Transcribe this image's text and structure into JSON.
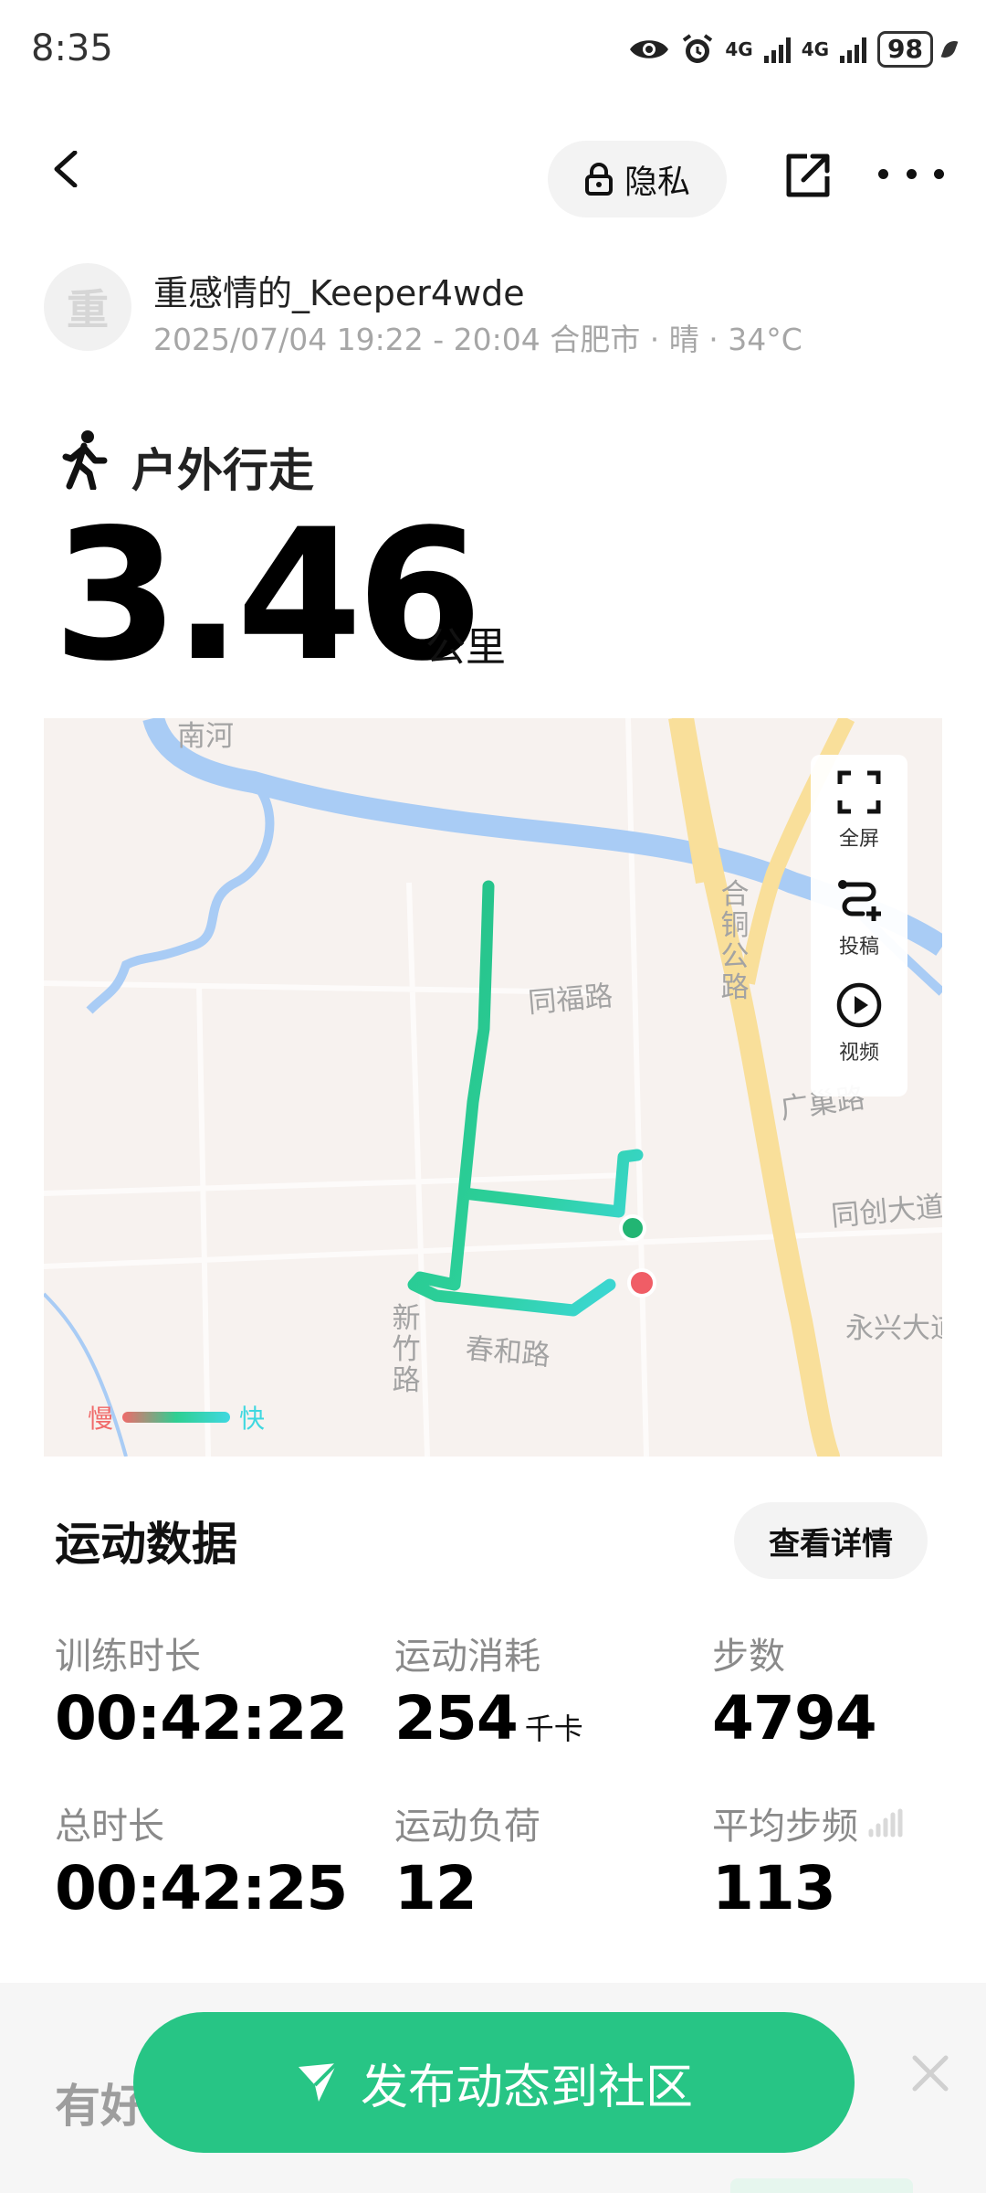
{
  "status_bar": {
    "time": "8:35",
    "signal_1": "4G",
    "signal_2": "4G",
    "battery": "98"
  },
  "header": {
    "privacy_label": "隐私",
    "back_icon": "chevron-left-icon",
    "share_icon": "share-icon",
    "more_icon": "more-icon"
  },
  "user": {
    "avatar_text": "重",
    "name": "重感情的_Keeper4wde",
    "meta": "2025/07/04 19:22 - 20:04 合肥市 · 晴 · 34°C"
  },
  "activity": {
    "type": "户外行走",
    "distance": "3.46",
    "unit": "公里"
  },
  "map": {
    "labels": {
      "river": "南河",
      "tongfu": "同福路",
      "guangchao": "广巢路",
      "tongchuang": "同创大道",
      "yongxing": "永兴大道",
      "chunhe": "春和路",
      "hetong": "合铜公路",
      "xinzhu": "新竹路"
    },
    "tools": {
      "fullscreen": "全屏",
      "post": "投稿",
      "video": "视频"
    },
    "legend": {
      "slow": "慢",
      "fast": "快"
    },
    "colors": {
      "route": "#26c48a",
      "start": "#22b573",
      "end": "#f05d66",
      "water": "#a9ccf5",
      "road": "#f9df9a"
    }
  },
  "stats": {
    "title": "运动数据",
    "details_button": "查看详情",
    "items": [
      {
        "label": "训练时长",
        "value": "00:42:22",
        "unit": ""
      },
      {
        "label": "运动消耗",
        "value": "254",
        "unit": "千卡"
      },
      {
        "label": "步数",
        "value": "4794",
        "unit": ""
      },
      {
        "label": "总时长",
        "value": "00:42:25",
        "unit": ""
      },
      {
        "label": "运动负荷",
        "value": "12",
        "unit": ""
      },
      {
        "label": "平均步频",
        "value": "113",
        "unit": ""
      }
    ]
  },
  "bottom": {
    "section_peek": "有好",
    "cta": "发布动态到社区",
    "accent": "#27c585"
  }
}
